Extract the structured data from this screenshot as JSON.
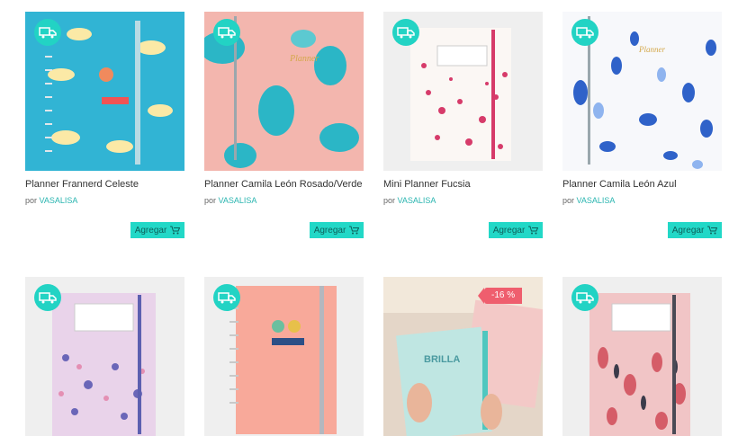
{
  "products": [
    {
      "title": "Planner Frannerd Celeste",
      "by": "por",
      "brand": "VASALISA",
      "add_label": "Agregar"
    },
    {
      "title": "Planner Camila León Rosado/Verde",
      "by": "por",
      "brand": "VASALISA",
      "add_label": "Agregar"
    },
    {
      "title": "Mini Planner Fucsia",
      "by": "por",
      "brand": "VASALISA",
      "add_label": "Agregar"
    },
    {
      "title": "Planner Camila León Azul",
      "by": "por",
      "brand": "VASALISA",
      "add_label": "Agregar"
    },
    {
      "title": "",
      "by": "",
      "brand": "",
      "add_label": ""
    },
    {
      "title": "",
      "by": "",
      "brand": "",
      "add_label": ""
    },
    {
      "title": "",
      "by": "",
      "brand": "",
      "add_label": "",
      "discount": "-16 %"
    },
    {
      "title": "",
      "by": "",
      "brand": "",
      "add_label": ""
    }
  ],
  "colors": {
    "accent": "#22d8c7",
    "brand": "#2ab5b0",
    "discount": "#ef5e6e"
  },
  "icons": {
    "shipping": "truck-icon",
    "cart": "cart-icon"
  }
}
